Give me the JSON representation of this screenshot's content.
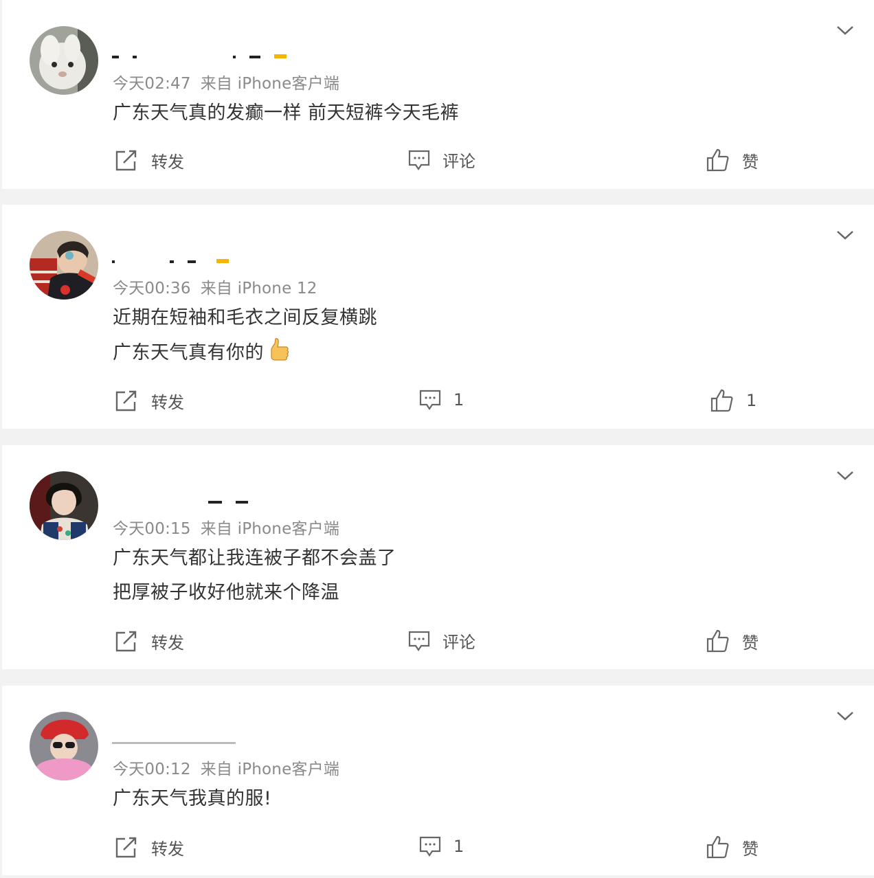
{
  "posts": [
    {
      "time": "今天02:47",
      "source": "来自 iPhone客户端",
      "lines": [
        "广东天气真的发癫一样 前天短裤今天毛裤"
      ],
      "repost_label": "转发",
      "comment_label": "评论",
      "like_label": "赞",
      "has_emoji": false,
      "avatar": "rabbit"
    },
    {
      "time": "今天00:36",
      "source": "来自 iPhone 12",
      "lines": [
        "近期在短袖和毛衣之间反复横跳",
        "广东天气真有你的"
      ],
      "repost_label": "转发",
      "comment_label": "1",
      "like_label": "1",
      "has_emoji": true,
      "avatar": "person-red"
    },
    {
      "time": "今天00:15",
      "source": "来自 iPhone客户端",
      "lines": [
        "广东天气都让我连被子都不会盖了",
        "把厚被子收好他就来个降温"
      ],
      "repost_label": "转发",
      "comment_label": "评论",
      "like_label": "赞",
      "has_emoji": false,
      "avatar": "person-dark"
    },
    {
      "time": "今天00:12",
      "source": "来自 iPhone客户端",
      "lines": [
        "广东天气我真的服!"
      ],
      "repost_label": "转发",
      "comment_label": "1",
      "like_label": "赞",
      "has_emoji": false,
      "avatar": "person-pink"
    }
  ],
  "icons": {
    "expand": "chevron-down-icon",
    "repost": "share-icon",
    "comment": "comment-icon",
    "like": "thumbs-up-icon",
    "emoji": "thumbs-up-emoji"
  },
  "colors": {
    "text": "#333333",
    "meta": "#8a8a8a",
    "action": "#555555",
    "background": "#f2f2f2",
    "card": "#ffffff"
  }
}
